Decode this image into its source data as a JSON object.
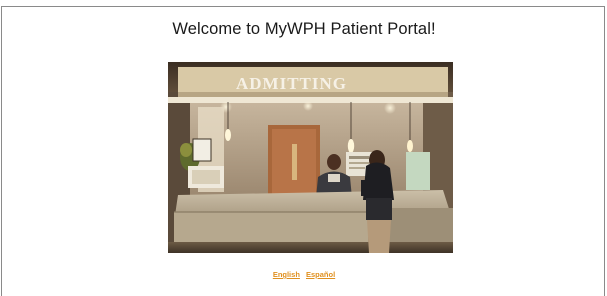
{
  "page": {
    "title": "Welcome to MyWPH Patient Portal!"
  },
  "photo": {
    "sign_text": "ADMITTING"
  },
  "languages": [
    {
      "label": "English"
    },
    {
      "label": "Español"
    }
  ],
  "colors": {
    "link": "#e0901e",
    "border": "#8a8a8a"
  }
}
